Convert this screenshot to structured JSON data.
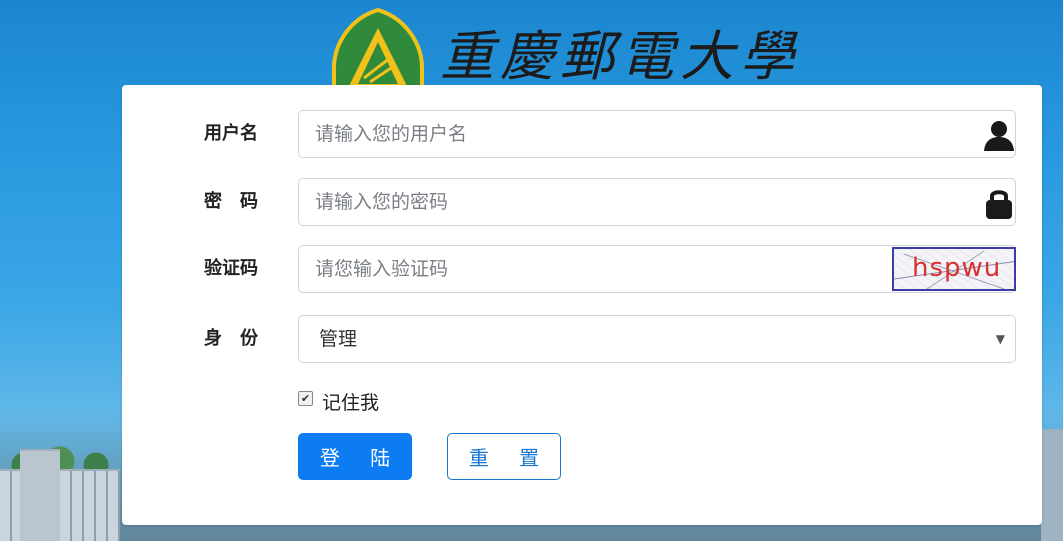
{
  "header": {
    "title": "重慶郵電大學"
  },
  "form": {
    "username": {
      "label": "用户名",
      "placeholder": "请输入您的用户名",
      "icon": "user-icon"
    },
    "password": {
      "label": "密　码",
      "placeholder": "请输入您的密码",
      "icon": "lock-icon"
    },
    "captcha": {
      "label": "验证码",
      "placeholder": "请您输入验证码",
      "image_text": "hspwu"
    },
    "identity": {
      "label": "身　份",
      "selected": "管理"
    },
    "remember": {
      "label": "记住我",
      "checked": true
    },
    "login_label": "登 陆",
    "reset_label": "重 置"
  },
  "colors": {
    "primary": "#0d7cf2",
    "reset_border": "#1976d2",
    "captcha_text": "#d93030"
  }
}
